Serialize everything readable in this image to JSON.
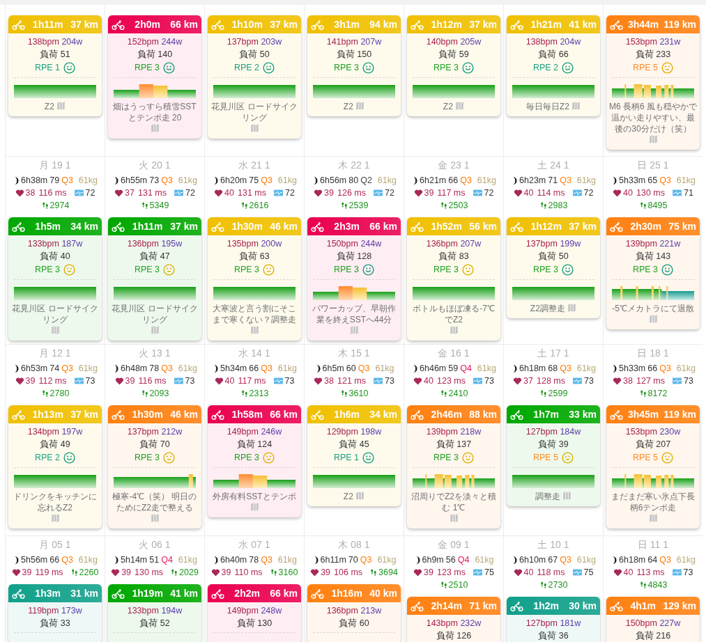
{
  "weeks": [
    {
      "days": [
        {
          "activity": {
            "color": "#f0c000",
            "duration": "1h11m",
            "distance": "37 km",
            "bpm": "138bpm",
            "watts": "204w",
            "load": "負荷 51",
            "rpe": {
              "text": "RPE 1",
              "color": "#1a9e80"
            },
            "face": {
              "kind": "happy"
            },
            "chart": {
              "kind": "flat"
            },
            "note": "Z2"
          }
        },
        {
          "activity": {
            "color": "#ea0050",
            "duration": "2h0m",
            "distance": "66 km",
            "bpm": "152bpm",
            "watts": "244w",
            "load": "負荷 140",
            "rpe": {
              "text": "RPE 3",
              "color": "#20a020"
            },
            "face": {
              "kind": "happy"
            },
            "chart": {
              "kind": "blocks"
            },
            "note": "畑はうっすら積雪SSTとテンポ走 20"
          }
        },
        {
          "activity": {
            "color": "#f0c000",
            "duration": "1h10m",
            "distance": "37 km",
            "bpm": "137bpm",
            "watts": "203w",
            "load": "負荷 50",
            "rpe": {
              "text": "RPE 2",
              "color": "#1a9e80"
            },
            "face": {
              "kind": "happy"
            },
            "chart": {
              "kind": "flat"
            },
            "note": "花見川区 ロードサイクリング"
          }
        },
        {
          "activity": {
            "color": "#f0c000",
            "duration": "3h1m",
            "distance": "94 km",
            "bpm": "141bpm",
            "watts": "207w",
            "load": "負荷 150",
            "rpe": {
              "text": "RPE 3",
              "color": "#20a020"
            },
            "face": {
              "kind": "happy"
            },
            "chart": {
              "kind": "flat"
            },
            "note": "Z2"
          }
        },
        {
          "activity": {
            "color": "#f0c000",
            "duration": "1h12m",
            "distance": "37 km",
            "bpm": "140bpm",
            "watts": "205w",
            "load": "負荷 59",
            "rpe": {
              "text": "RPE 3",
              "color": "#20a020"
            },
            "face": {
              "kind": "happy"
            },
            "chart": {
              "kind": "flat"
            },
            "note": "Z2"
          }
        },
        {
          "activity": {
            "color": "#f0c000",
            "duration": "1h21m",
            "distance": "41 km",
            "bpm": "138bpm",
            "watts": "204w",
            "load": "負荷 66",
            "rpe": {
              "text": "RPE 2",
              "color": "#1a9e80"
            },
            "face": {
              "kind": "happy"
            },
            "chart": {
              "kind": "flat"
            },
            "note": "毎日毎日Z2"
          }
        },
        {
          "activity": {
            "color": "#ff8010",
            "duration": "3h44m",
            "distance": "119 km",
            "bpm": "153bpm",
            "watts": "231w",
            "load": "負荷 233",
            "rpe": {
              "text": "RPE 5",
              "color": "#ff8a20"
            },
            "face": {
              "kind": "neutral"
            },
            "chart": {
              "kind": "spikes"
            },
            "note": "M6 長柄6 風も穏やかで温かい走りやすい、最後の30分だけ（笑）"
          }
        }
      ]
    },
    {
      "days": [
        {
          "date": "月 19 1",
          "sleep": "6h38m",
          "sleep_score": "79",
          "quality": {
            "text": "Q3",
            "color": "#ff7a00"
          },
          "weight": "61kg",
          "resting_hr": "38",
          "hrv": "116 ms",
          "stress": "72",
          "steps": "2974",
          "activity": {
            "color": "#00a800",
            "duration": "1h5m",
            "distance": "34 km",
            "bpm": "133bpm",
            "watts": "187w",
            "load": "負荷 40",
            "rpe": {
              "text": "RPE 3",
              "color": "#20a020"
            },
            "face": {
              "kind": "neutral"
            },
            "chart": {
              "kind": "flat"
            },
            "note": "花見川区 ロードサイクリング"
          }
        },
        {
          "date": "火 20 1",
          "sleep": "6h55m",
          "sleep_score": "73",
          "quality": {
            "text": "Q3",
            "color": "#ff7a00"
          },
          "weight": "61kg",
          "resting_hr": "37",
          "hrv": "131 ms",
          "stress": "72",
          "steps": "5349",
          "activity": {
            "color": "#00a800",
            "duration": "1h11m",
            "distance": "37 km",
            "bpm": "136bpm",
            "watts": "195w",
            "load": "負荷 47",
            "rpe": {
              "text": "RPE 3",
              "color": "#20a020"
            },
            "face": {
              "kind": "neutral"
            },
            "chart": {
              "kind": "flat"
            },
            "note": "花見川区 ロードサイクリング"
          }
        },
        {
          "date": "水 21 1",
          "sleep": "6h20m",
          "sleep_score": "75",
          "quality": {
            "text": "Q3",
            "color": "#ff7a00"
          },
          "weight": "61kg",
          "resting_hr": "40",
          "hrv": "131 ms",
          "stress": "72",
          "steps": "2616",
          "activity": {
            "color": "#f0c000",
            "duration": "1h30m",
            "distance": "46 km",
            "bpm": "135bpm",
            "watts": "200w",
            "load": "負荷 63",
            "rpe": {
              "text": "RPE 3",
              "color": "#20a020"
            },
            "face": {
              "kind": "neutral"
            },
            "chart": {
              "kind": "flat"
            },
            "note": "大寒波と言う割にそこまで寒くない？調整走"
          }
        },
        {
          "date": "木 22 1",
          "sleep": "6h56m",
          "sleep_score": "80",
          "quality": {
            "text": "Q2",
            "color": "#444444"
          },
          "weight": "61kg",
          "resting_hr": "39",
          "hrv": "126 ms",
          "stress": "72",
          "steps": "2539",
          "activity": {
            "color": "#ea0050",
            "duration": "2h3m",
            "distance": "66 km",
            "bpm": "150bpm",
            "watts": "244w",
            "load": "負荷 128",
            "rpe": {
              "text": "RPE 3",
              "color": "#20a020"
            },
            "face": {
              "kind": "happy"
            },
            "chart": {
              "kind": "blocks"
            },
            "note": "パワーカップ、早朝作業を終えSSTへ44分"
          }
        },
        {
          "date": "金 23 1",
          "sleep": "6h21m",
          "sleep_score": "66",
          "quality": {
            "text": "Q3",
            "color": "#ff7a00"
          },
          "weight": "61kg",
          "resting_hr": "39",
          "hrv": "117 ms",
          "stress": "72",
          "steps": "2503",
          "activity": {
            "color": "#f0c000",
            "duration": "1h52m",
            "distance": "56 km",
            "bpm": "136bpm",
            "watts": "207w",
            "load": "負荷 83",
            "rpe": {
              "text": "RPE 3",
              "color": "#20a020"
            },
            "face": {
              "kind": "neutral"
            },
            "chart": {
              "kind": "flat"
            },
            "note": "ボトルもほぼ凍る-7℃でZ2"
          }
        },
        {
          "date": "土 24 1",
          "sleep": "6h23m",
          "sleep_score": "71",
          "quality": {
            "text": "Q3",
            "color": "#ff7a00"
          },
          "weight": "61kg",
          "resting_hr": "40",
          "hrv": "114 ms",
          "stress": "72",
          "steps": "2983",
          "activity": {
            "color": "#f0c000",
            "duration": "1h12m",
            "distance": "37 km",
            "bpm": "137bpm",
            "watts": "199w",
            "load": "負荷 50",
            "rpe": {
              "text": "RPE 3",
              "color": "#20a020"
            },
            "face": {
              "kind": "happy"
            },
            "chart": {
              "kind": "flat"
            },
            "note": "Z2調整走"
          }
        },
        {
          "date": "日 25 1",
          "sleep": "5h33m",
          "sleep_score": "65",
          "quality": {
            "text": "Q3",
            "color": "#ff7a00"
          },
          "weight": "61kg",
          "resting_hr": "40",
          "hrv": "130 ms",
          "stress": "71",
          "steps": "8495",
          "activity": {
            "color": "#ff8010",
            "duration": "2h30m",
            "distance": "75 km",
            "bpm": "139bpm",
            "watts": "221w",
            "load": "負荷 143",
            "rpe": {
              "text": "RPE 3",
              "color": "#20a020"
            },
            "face": {
              "kind": "happy"
            },
            "chart": {
              "kind": "teal_spikes"
            },
            "note": "-5℃メカトラにて退散"
          }
        }
      ]
    },
    {
      "days": [
        {
          "date": "月 12 1",
          "sleep": "6h53m",
          "sleep_score": "74",
          "quality": {
            "text": "Q3",
            "color": "#ff7a00"
          },
          "weight": "61kg",
          "resting_hr": "39",
          "hrv": "112 ms",
          "stress": "73",
          "steps": "2780",
          "activity": {
            "color": "#f0c000",
            "duration": "1h13m",
            "distance": "37 km",
            "bpm": "134bpm",
            "watts": "197w",
            "load": "負荷 49",
            "rpe": {
              "text": "RPE 2",
              "color": "#1a9e80"
            },
            "face": {
              "kind": "happy"
            },
            "chart": {
              "kind": "flat"
            },
            "note": "ドリンクをキッチンに忘れるZ2"
          }
        },
        {
          "date": "火 13 1",
          "sleep": "6h48m",
          "sleep_score": "78",
          "quality": {
            "text": "Q3",
            "color": "#ff7a00"
          },
          "weight": "61kg",
          "resting_hr": "39",
          "hrv": "116 ms",
          "stress": "73",
          "steps": "2093",
          "activity": {
            "color": "#ff8010",
            "duration": "1h30m",
            "distance": "46 km",
            "bpm": "137bpm",
            "watts": "212w",
            "load": "負荷 70",
            "rpe": {
              "text": "RPE 3",
              "color": "#20a020"
            },
            "face": {
              "kind": "neutral"
            },
            "chart": {
              "kind": "end_spike"
            },
            "note": "極寒-4℃（笑） 明日のためにZ2走で整える"
          }
        },
        {
          "date": "水 14 1",
          "sleep": "5h34m",
          "sleep_score": "66",
          "quality": {
            "text": "Q3",
            "color": "#ff7a00"
          },
          "weight": "61kg",
          "resting_hr": "40",
          "hrv": "117 ms",
          "stress": "73",
          "steps": "2313",
          "activity": {
            "color": "#ea0050",
            "duration": "1h58m",
            "distance": "66 km",
            "bpm": "149bpm",
            "watts": "246w",
            "load": "負荷 124",
            "rpe": {
              "text": "RPE 3",
              "color": "#20a020"
            },
            "face": {
              "kind": "neutral"
            },
            "chart": {
              "kind": "blocks"
            },
            "note": "外房有料SSTとテンポ"
          }
        },
        {
          "date": "木 15 1",
          "sleep": "6h5m",
          "sleep_score": "60",
          "quality": {
            "text": "Q3",
            "color": "#ff7a00"
          },
          "weight": "61kg",
          "resting_hr": "38",
          "hrv": "121 ms",
          "stress": "73",
          "steps": "3610",
          "activity": {
            "color": "#f0c000",
            "duration": "1h6m",
            "distance": "34 km",
            "bpm": "129bpm",
            "watts": "198w",
            "load": "負荷 45",
            "rpe": {
              "text": "RPE 1",
              "color": "#1a9e80"
            },
            "face": {
              "kind": "happy"
            },
            "chart": {
              "kind": "flat"
            },
            "note": "Z2"
          }
        },
        {
          "date": "金 16 1",
          "sleep": "6h46m",
          "sleep_score": "59",
          "quality": {
            "text": "Q4",
            "color": "#e8185a"
          },
          "weight": "61kg",
          "resting_hr": "40",
          "hrv": "123 ms",
          "stress": "73",
          "steps": "2410",
          "activity": {
            "color": "#ff8010",
            "duration": "2h46m",
            "distance": "88 km",
            "bpm": "139bpm",
            "watts": "218w",
            "load": "負荷 137",
            "rpe": {
              "text": "RPE 3",
              "color": "#20a020"
            },
            "face": {
              "kind": "neutral"
            },
            "chart": {
              "kind": "spikes"
            },
            "note": "沼周りでZ2を淡々と積む 1℃"
          }
        },
        {
          "date": "土 17 1",
          "sleep": "6h18m",
          "sleep_score": "68",
          "quality": {
            "text": "Q3",
            "color": "#ff7a00"
          },
          "weight": "61kg",
          "resting_hr": "37",
          "hrv": "128 ms",
          "stress": "73",
          "steps": "2599",
          "activity": {
            "color": "#00a800",
            "duration": "1h7m",
            "distance": "33 km",
            "bpm": "127bpm",
            "watts": "184w",
            "load": "負荷 39",
            "rpe": {
              "text": "RPE 5",
              "color": "#ff8a20"
            },
            "face": {
              "kind": "neutral"
            },
            "chart": {
              "kind": "flat"
            },
            "note": "調整走"
          }
        },
        {
          "date": "日 18 1",
          "sleep": "5h33m",
          "sleep_score": "66",
          "quality": {
            "text": "Q3",
            "color": "#ff7a00"
          },
          "weight": "61kg",
          "resting_hr": "38",
          "hrv": "127 ms",
          "stress": "73",
          "steps": "8172",
          "activity": {
            "color": "#ff8010",
            "duration": "3h45m",
            "distance": "119 km",
            "bpm": "153bpm",
            "watts": "230w",
            "load": "負荷 207",
            "rpe": {
              "text": "RPE 5",
              "color": "#ff8a20"
            },
            "face": {
              "kind": "neutral"
            },
            "chart": {
              "kind": "spikes"
            },
            "note": "まだまだ寒い氷点下長柄6テンポ走"
          }
        }
      ]
    },
    {
      "days": [
        {
          "date": "月 05 1",
          "sleep": "5h56m",
          "sleep_score": "66",
          "quality": {
            "text": "Q3",
            "color": "#ff7a00"
          },
          "weight": "61kg",
          "resting_hr": "39",
          "hrv": "119 ms",
          "steps": "2260",
          "activity": {
            "color": "#10a08a",
            "duration": "1h3m",
            "distance": "31 km",
            "bpm": "119bpm",
            "watts": "173w",
            "load": "負荷 33"
          }
        },
        {
          "date": "火 06 1",
          "sleep": "5h14m",
          "sleep_score": "51",
          "quality": {
            "text": "Q4",
            "color": "#e8185a"
          },
          "weight": "61kg",
          "resting_hr": "39",
          "hrv": "130 ms",
          "steps": "2029",
          "activity": {
            "color": "#00a800",
            "duration": "1h19m",
            "distance": "41 km",
            "bpm": "133bpm",
            "watts": "194w",
            "load": "負荷 52"
          }
        },
        {
          "date": "水 07 1",
          "sleep": "6h40m",
          "sleep_score": "78",
          "quality": {
            "text": "Q3",
            "color": "#ff7a00"
          },
          "weight": "61kg",
          "resting_hr": "39",
          "hrv": "110 ms",
          "steps": "3160",
          "activity": {
            "color": "#ea0050",
            "duration": "2h2m",
            "distance": "66 km",
            "bpm": "149bpm",
            "watts": "248w",
            "load": "負荷 130"
          }
        },
        {
          "date": "木 08 1",
          "sleep": "6h11m",
          "sleep_score": "70",
          "quality": {
            "text": "Q3",
            "color": "#ff7a00"
          },
          "weight": "61kg",
          "resting_hr": "39",
          "hrv": "106 ms",
          "steps": "3694",
          "activity": {
            "color": "#ff8010",
            "duration": "1h16m",
            "distance": "40 km",
            "bpm": "136bpm",
            "watts": "213w",
            "load": "負荷 60"
          }
        },
        {
          "date": "金 09 1",
          "sleep": "6h9m",
          "sleep_score": "56",
          "quality": {
            "text": "Q4",
            "color": "#e8185a"
          },
          "weight": "61kg",
          "resting_hr": "39",
          "hrv": "123 ms",
          "stress": "75",
          "steps": "2510",
          "activity": {
            "color": "#ff8010",
            "duration": "2h14m",
            "distance": "71 km",
            "bpm": "143bpm",
            "watts": "232w",
            "load": "負荷 126"
          }
        },
        {
          "date": "土 10 1",
          "sleep": "6h10m",
          "sleep_score": "67",
          "quality": {
            "text": "Q3",
            "color": "#ff7a00"
          },
          "weight": "61kg",
          "resting_hr": "40",
          "hrv": "118 ms",
          "stress": "75",
          "steps": "2730",
          "activity": {
            "color": "#10a08a",
            "duration": "1h2m",
            "distance": "30 km",
            "bpm": "127bpm",
            "watts": "181w",
            "load": "負荷 36"
          }
        },
        {
          "date": "日 11 1",
          "sleep": "6h18m",
          "sleep_score": "64",
          "quality": {
            "text": "Q3",
            "color": "#ff7a00"
          },
          "weight": "61kg",
          "resting_hr": "40",
          "hrv": "113 ms",
          "stress": "73",
          "steps": "4843",
          "activity": {
            "color": "#ff8010",
            "duration": "4h1m",
            "distance": "129 km",
            "bpm": "150bpm",
            "watts": "227w",
            "load": "負荷 216"
          }
        }
      ]
    }
  ]
}
